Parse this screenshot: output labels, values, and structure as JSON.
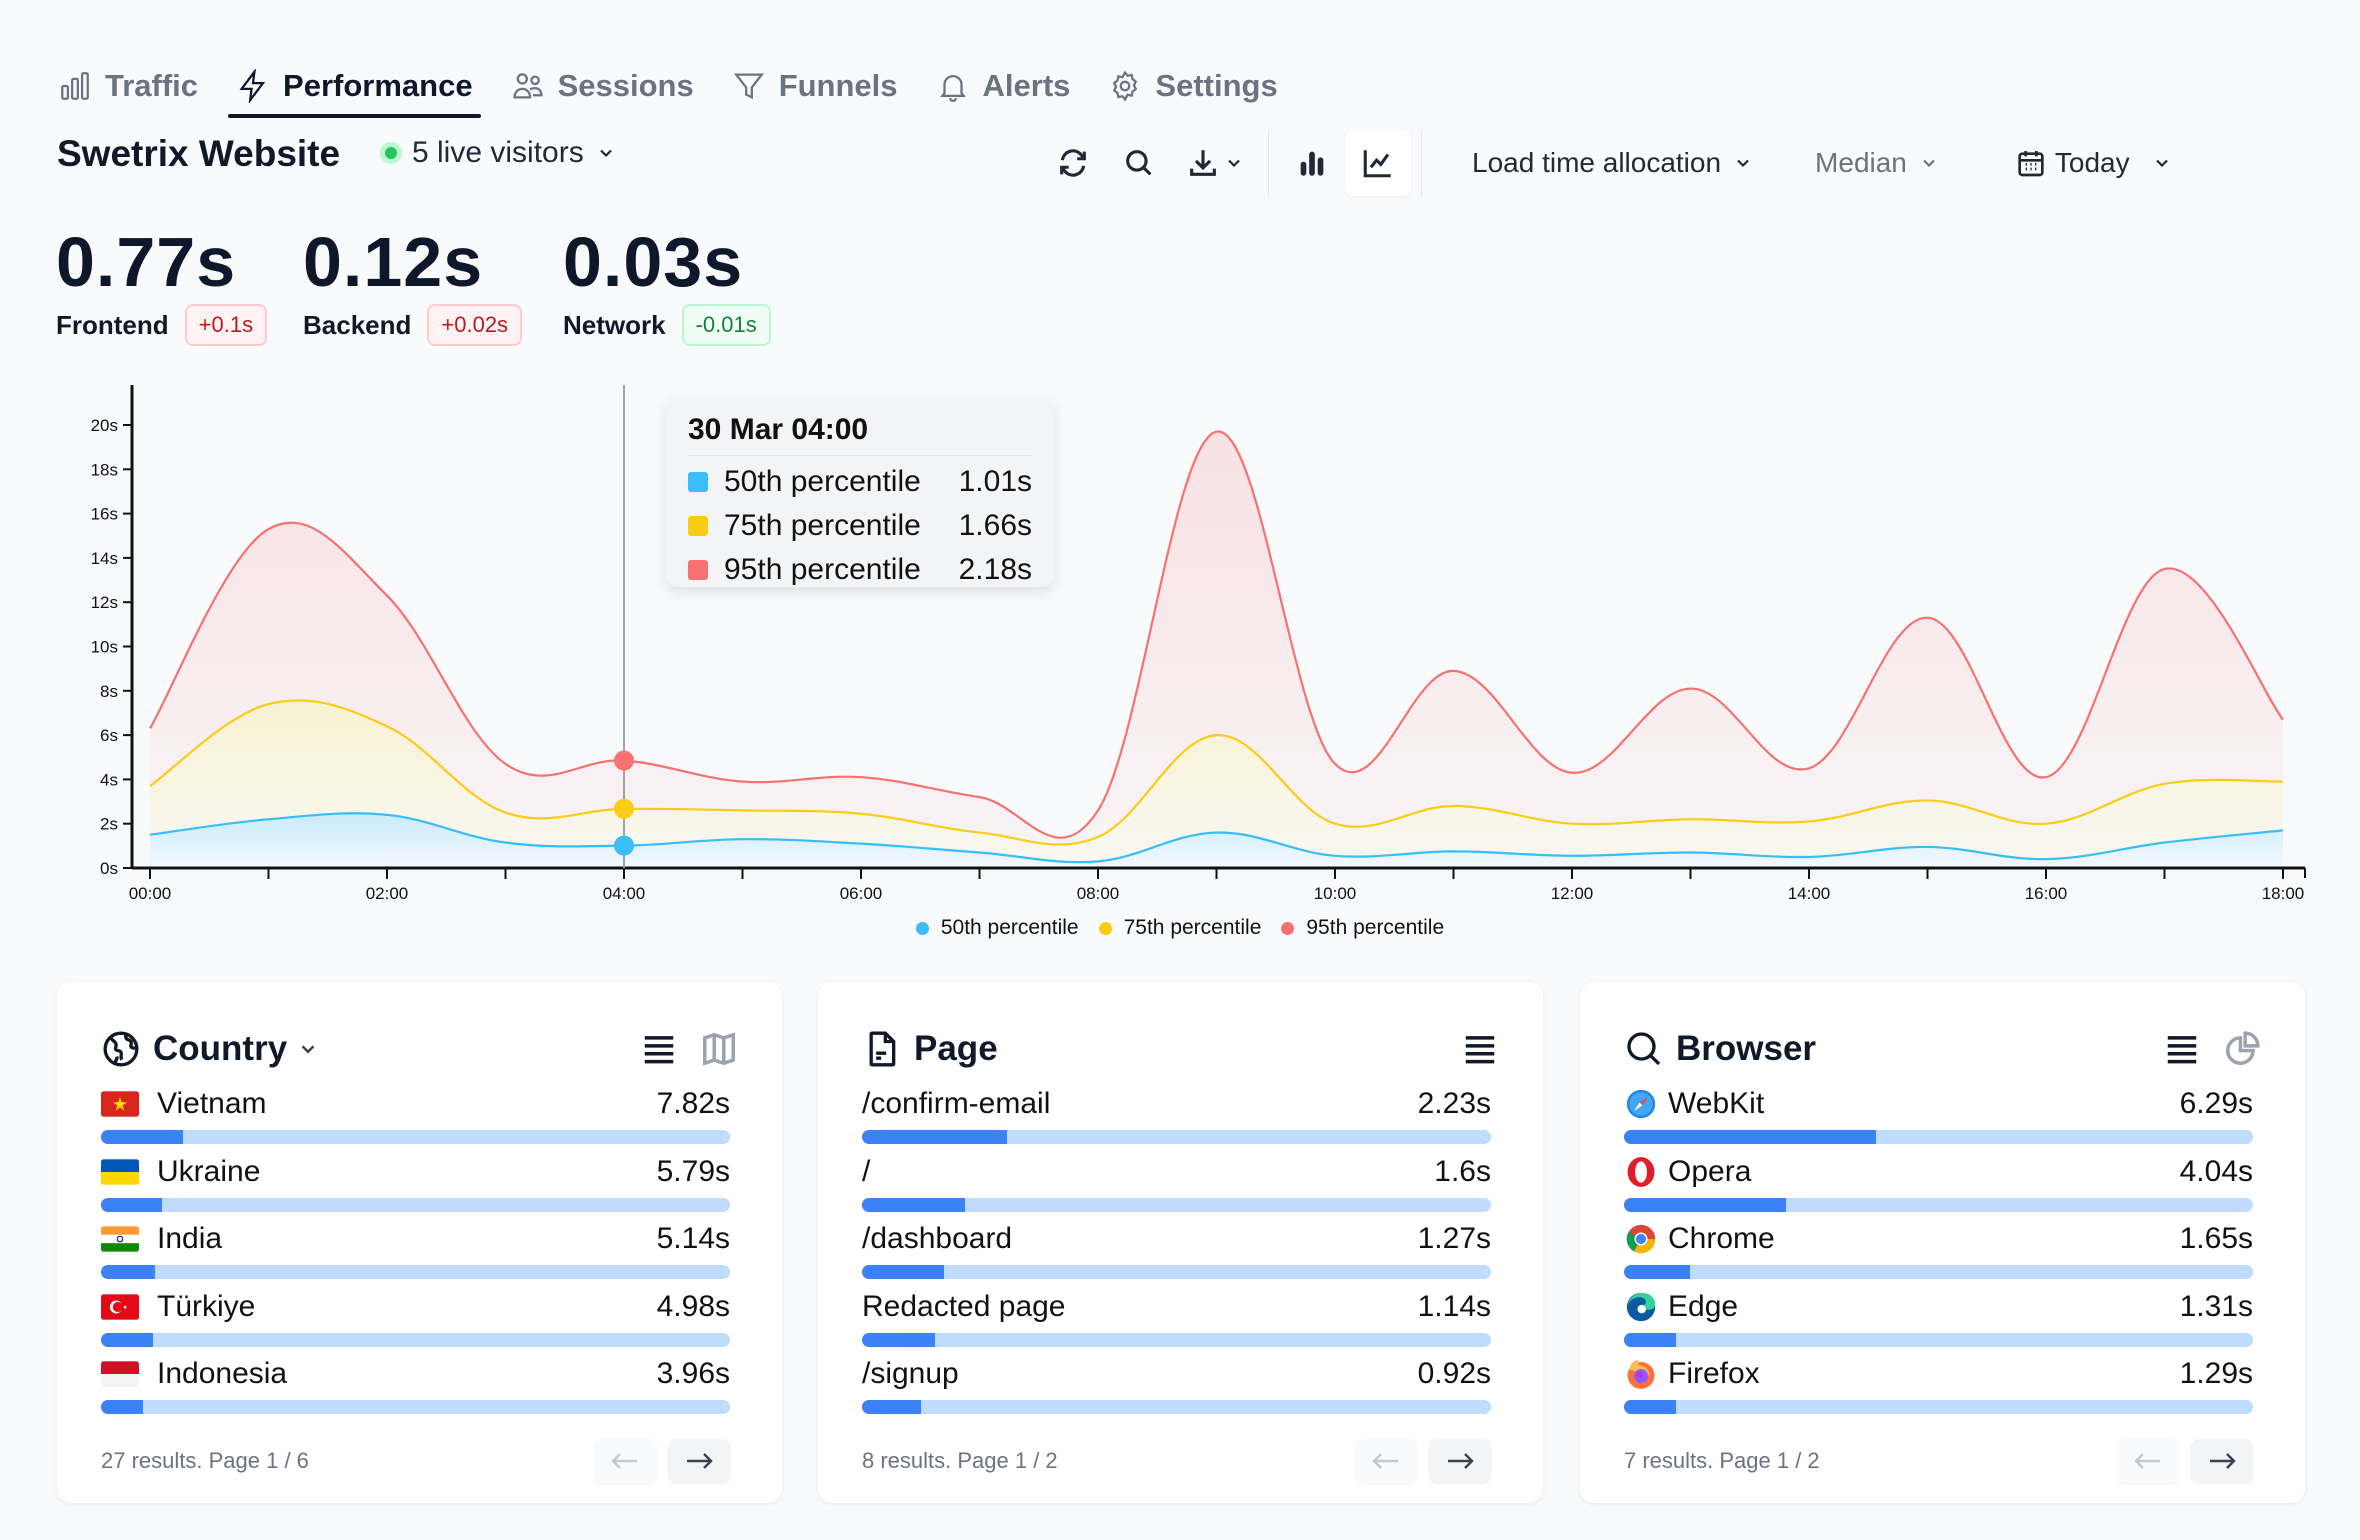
{
  "tabs": [
    {
      "label": "Traffic",
      "icon": "bar-chart-icon",
      "active": false
    },
    {
      "label": "Performance",
      "icon": "bolt-icon",
      "active": true
    },
    {
      "label": "Sessions",
      "icon": "users-icon",
      "active": false
    },
    {
      "label": "Funnels",
      "icon": "funnel-icon",
      "active": false
    },
    {
      "label": "Alerts",
      "icon": "bell-icon",
      "active": false
    },
    {
      "label": "Settings",
      "icon": "gear-icon",
      "active": false
    }
  ],
  "header": {
    "title": "Swetrix Website",
    "live_visitors": "5 live visitors"
  },
  "toolbar": {
    "refresh_icon": "refresh-icon",
    "search_icon": "search-icon",
    "download_icon": "download-icon",
    "bar_chart_icon": "bar-chart-icon",
    "line_chart_icon": "line-chart-icon",
    "metric_dropdown": "Load time allocation",
    "aggregation_dropdown": "Median",
    "period_dropdown": "Today"
  },
  "stats": [
    {
      "value": "0.77s",
      "label": "Frontend",
      "delta": "+0.1s",
      "trend": "up"
    },
    {
      "value": "0.12s",
      "label": "Backend",
      "delta": "+0.02s",
      "trend": "up"
    },
    {
      "value": "0.03s",
      "label": "Network",
      "delta": "-0.01s",
      "trend": "down"
    }
  ],
  "tooltip": {
    "title": "30 Mar 04:00",
    "rows": [
      {
        "label": "50th percentile",
        "value": "1.01s"
      },
      {
        "label": "75th percentile",
        "value": "1.66s"
      },
      {
        "label": "95th percentile",
        "value": "2.18s"
      }
    ]
  },
  "chart_data": {
    "type": "area",
    "stacked": true,
    "title": "",
    "xlabel": "",
    "ylabel": "",
    "x": [
      "00:00",
      "01:00",
      "02:00",
      "03:00",
      "04:00",
      "05:00",
      "06:00",
      "07:00",
      "08:00",
      "09:00",
      "10:00",
      "11:00",
      "12:00",
      "13:00",
      "14:00",
      "15:00",
      "16:00",
      "17:00",
      "18:00"
    ],
    "x_tick_labels": [
      "00:00",
      "02:00",
      "04:00",
      "06:00",
      "08:00",
      "10:00",
      "12:00",
      "14:00",
      "16:00",
      "18:00"
    ],
    "y_tick_labels": [
      "0s",
      "2s",
      "4s",
      "6s",
      "8s",
      "10s",
      "12s",
      "14s",
      "16s",
      "18s",
      "20s"
    ],
    "ylim": [
      0,
      21.5
    ],
    "grid": false,
    "legend_position": "bottom-center",
    "highlight_x": "04:00",
    "series": [
      {
        "name": "50th percentile",
        "color": "#38bdf8",
        "values": [
          1.5,
          2.2,
          2.4,
          1.15,
          1.01,
          1.3,
          1.1,
          0.7,
          0.3,
          1.6,
          0.55,
          0.75,
          0.55,
          0.7,
          0.5,
          0.95,
          0.4,
          1.15,
          1.7
        ]
      },
      {
        "name": "75th percentile",
        "color": "#facc15",
        "values": [
          2.2,
          5.2,
          4.0,
          1.35,
          1.66,
          1.3,
          1.35,
          0.9,
          1.1,
          4.4,
          1.45,
          2.05,
          1.45,
          1.5,
          1.6,
          2.1,
          1.6,
          2.65,
          2.2
        ]
      },
      {
        "name": "95th percentile",
        "color": "#f87171",
        "values": [
          2.6,
          7.9,
          5.9,
          2.2,
          2.18,
          1.3,
          1.65,
          1.6,
          1.2,
          13.7,
          2.7,
          6.1,
          2.3,
          5.9,
          2.4,
          8.25,
          2.1,
          9.7,
          2.8
        ]
      }
    ]
  },
  "panels": [
    {
      "title": "Country",
      "has_dropdown": true,
      "rows": [
        {
          "name": "Vietnam",
          "value": "7.82s",
          "fill": 0.13,
          "flag": "vn"
        },
        {
          "name": "Ukraine",
          "value": "5.79s",
          "fill": 0.097,
          "flag": "ua"
        },
        {
          "name": "India",
          "value": "5.14s",
          "fill": 0.086,
          "flag": "in"
        },
        {
          "name": "Türkiye",
          "value": "4.98s",
          "fill": 0.082,
          "flag": "tr"
        },
        {
          "name": "Indonesia",
          "value": "3.96s",
          "fill": 0.066,
          "flag": "id"
        }
      ],
      "footer": "27 results. Page 1 / 6"
    },
    {
      "title": "Page",
      "has_dropdown": false,
      "rows": [
        {
          "name": "/confirm-email",
          "value": "2.23s",
          "fill": 0.23
        },
        {
          "name": "/",
          "value": "1.6s",
          "fill": 0.164
        },
        {
          "name": "/dashboard",
          "value": "1.27s",
          "fill": 0.13
        },
        {
          "name": "Redacted page",
          "value": "1.14s",
          "fill": 0.116
        },
        {
          "name": "/signup",
          "value": "0.92s",
          "fill": 0.094
        }
      ],
      "footer": "8 results. Page 1 / 2"
    },
    {
      "title": "Browser",
      "has_dropdown": false,
      "rows": [
        {
          "name": "WebKit",
          "value": "6.29s",
          "fill": 0.4,
          "icon": "webkit"
        },
        {
          "name": "Opera",
          "value": "4.04s",
          "fill": 0.258,
          "icon": "opera"
        },
        {
          "name": "Chrome",
          "value": "1.65s",
          "fill": 0.105,
          "icon": "chrome"
        },
        {
          "name": "Edge",
          "value": "1.31s",
          "fill": 0.083,
          "icon": "edge"
        },
        {
          "name": "Firefox",
          "value": "1.29s",
          "fill": 0.082,
          "icon": "firefox"
        }
      ],
      "footer": "7 results. Page 1 / 2"
    }
  ]
}
